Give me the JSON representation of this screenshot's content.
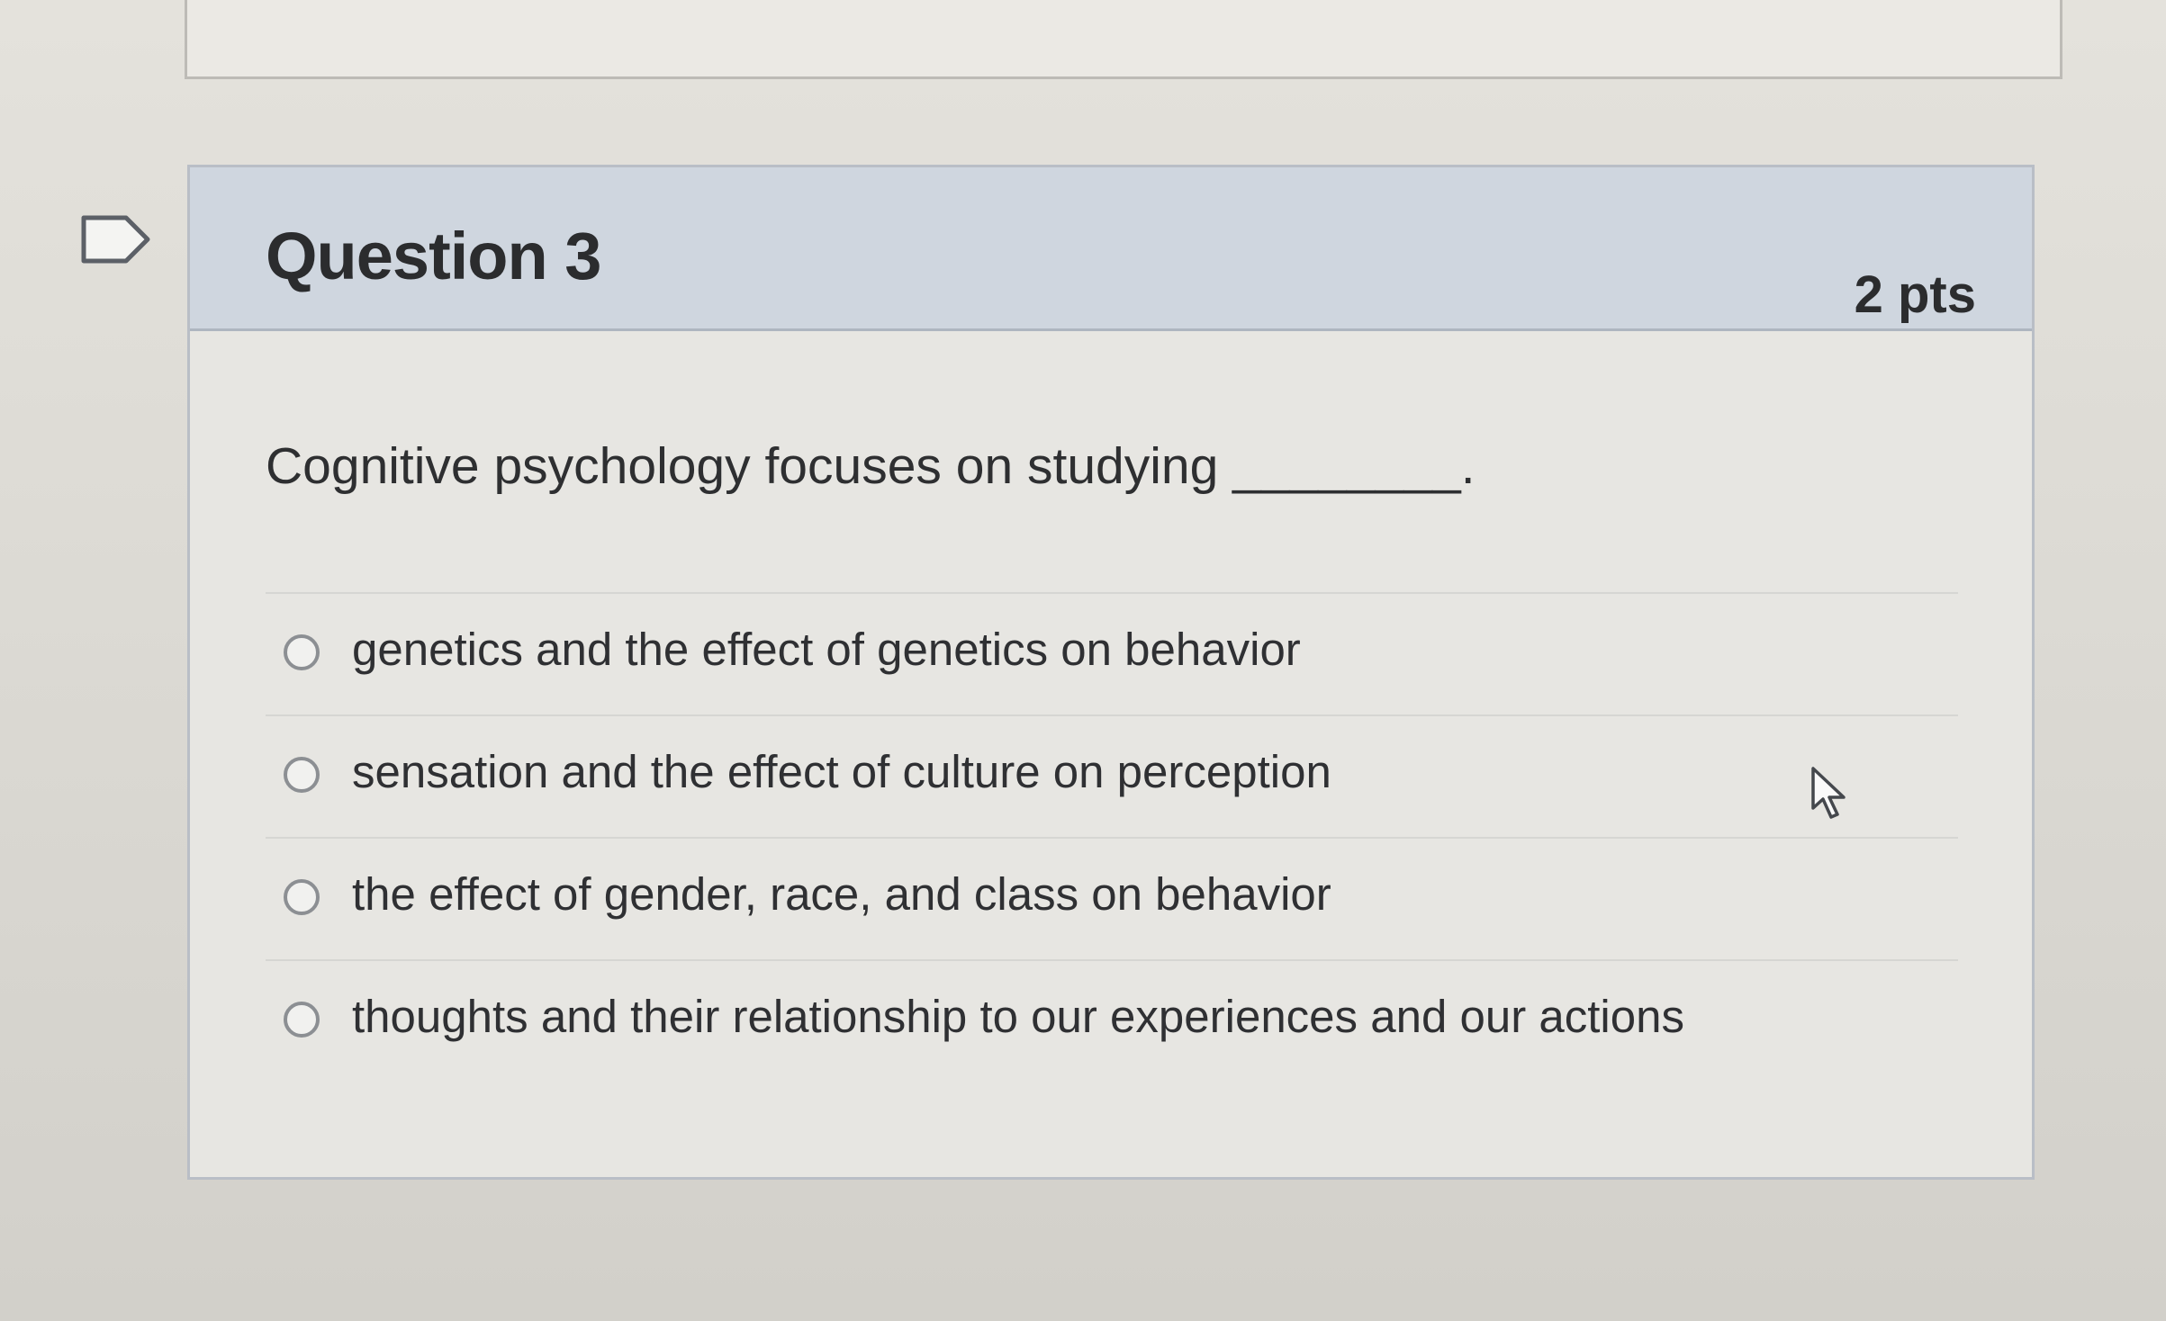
{
  "question": {
    "title": "Question 3",
    "points": "2 pts",
    "text": "Cognitive psychology focuses on studying ________.",
    "answers": [
      {
        "label": "genetics and the effect of genetics on behavior"
      },
      {
        "label": "sensation and the effect of culture on perception"
      },
      {
        "label": "the effect of gender, race, and class on behavior"
      },
      {
        "label": "thoughts and their relationship to our experiences and our actions"
      }
    ]
  },
  "icons": {
    "flag": "flag-question-icon",
    "cursor": "mouse-pointer-icon"
  },
  "colors": {
    "header_bg": "#cfd6df",
    "card_bg": "#e7e6e2",
    "text": "#2b2c2e"
  }
}
